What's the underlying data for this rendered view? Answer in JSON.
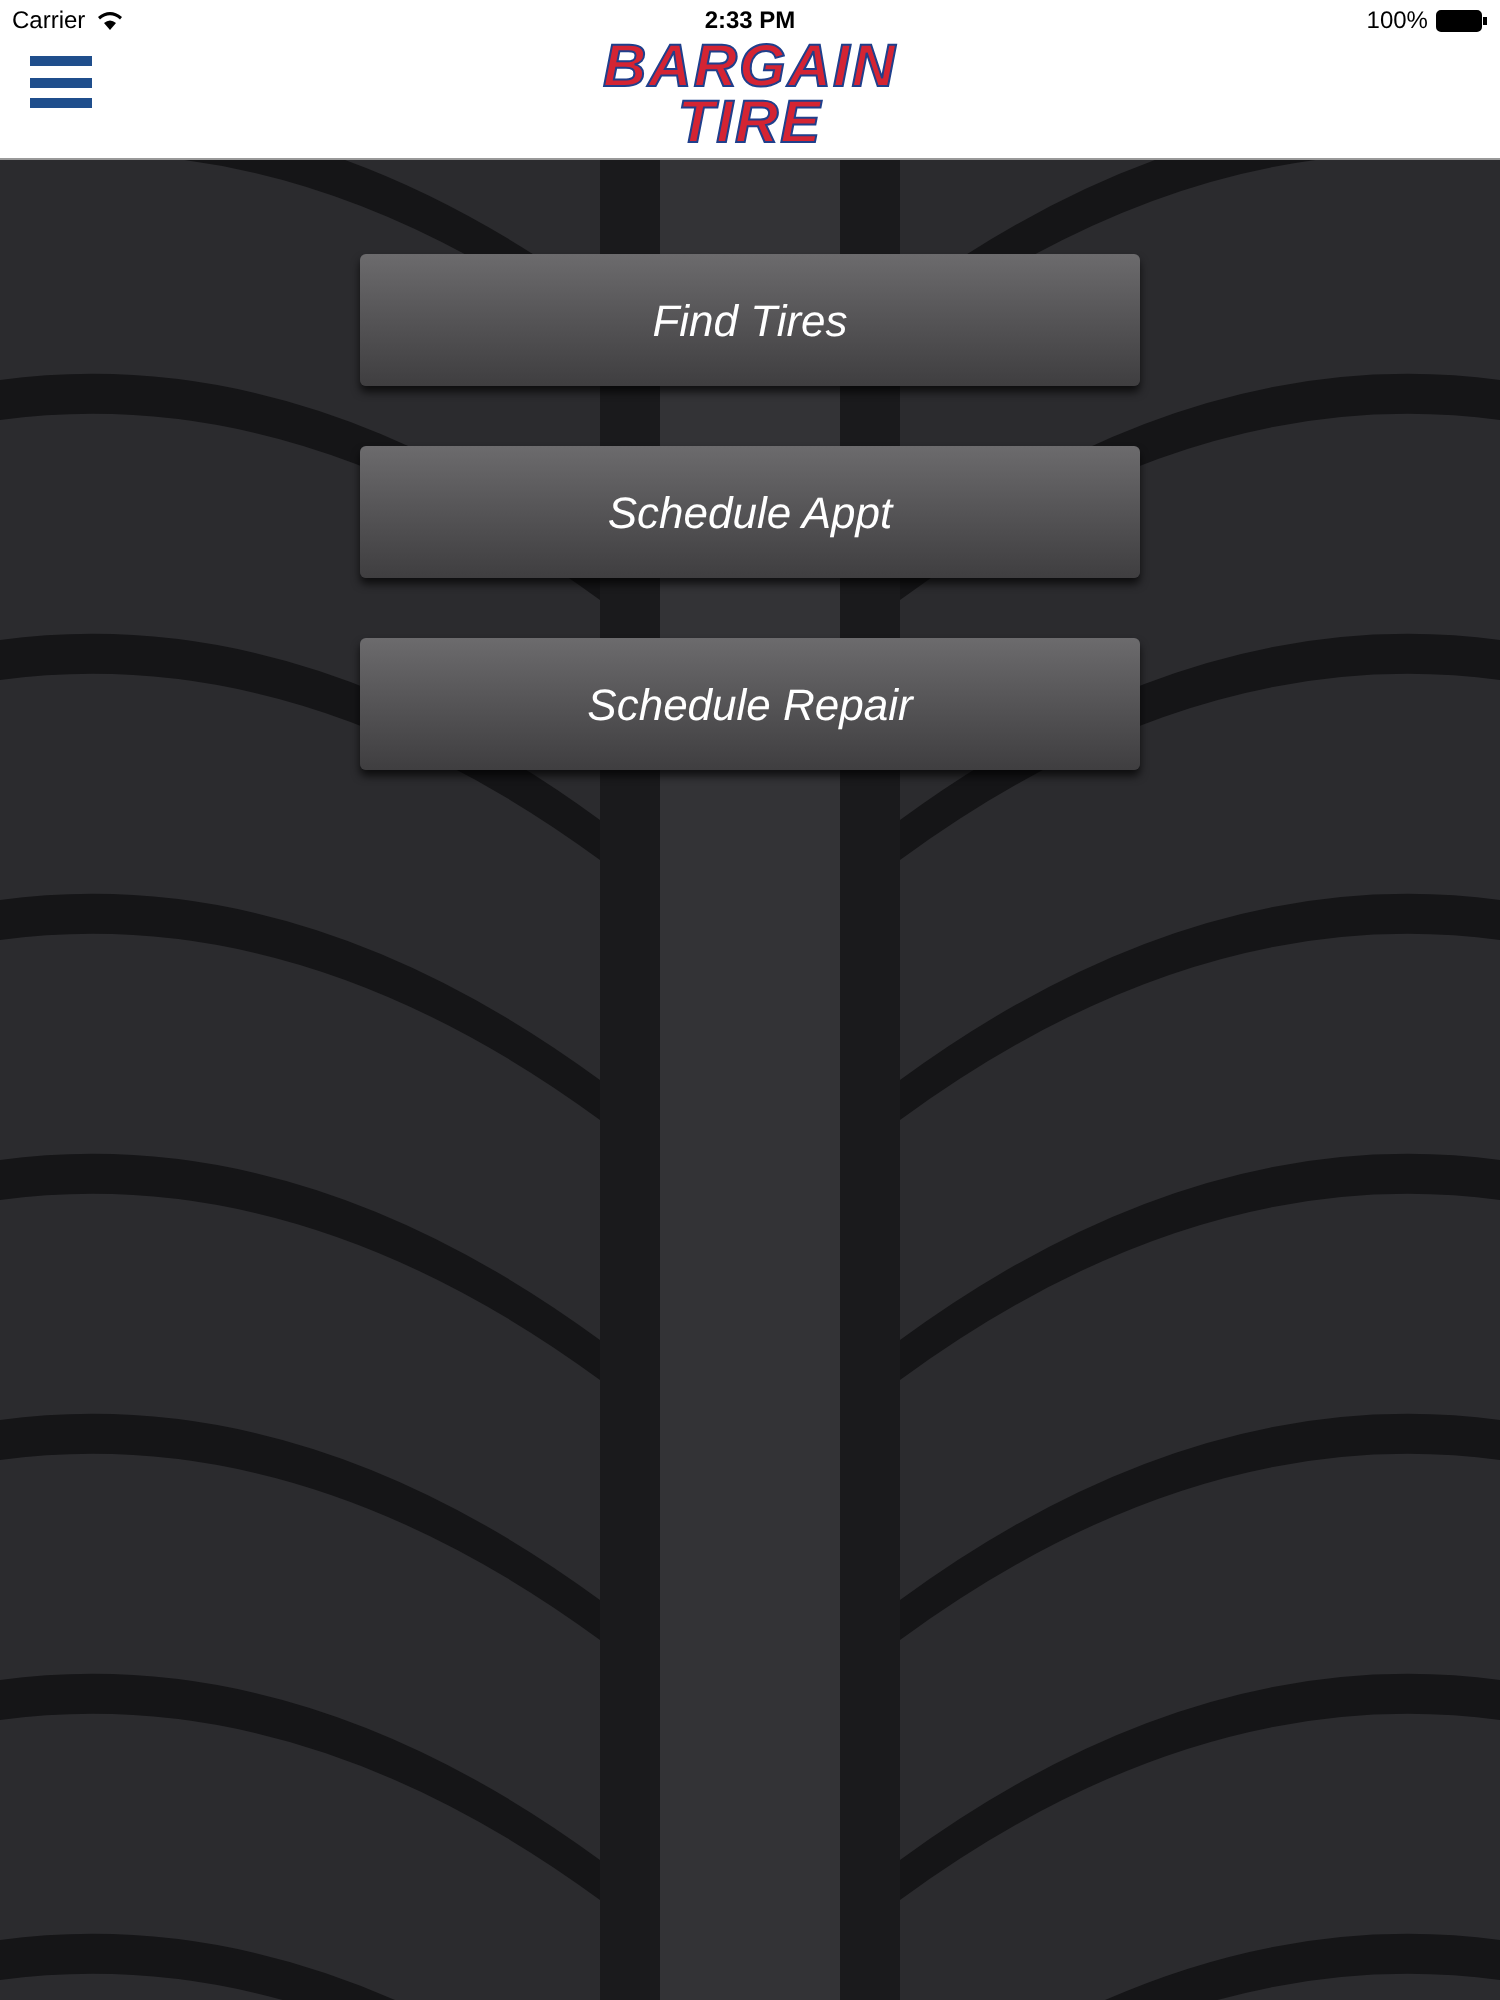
{
  "status_bar": {
    "carrier": "Carrier",
    "time": "2:33 PM",
    "battery": "100%"
  },
  "header": {
    "logo_lines": [
      "BARGAIN",
      "TIRE"
    ]
  },
  "buttons": [
    {
      "label": "Find Tires"
    },
    {
      "label": "Schedule Appt"
    },
    {
      "label": "Schedule Repair"
    }
  ]
}
